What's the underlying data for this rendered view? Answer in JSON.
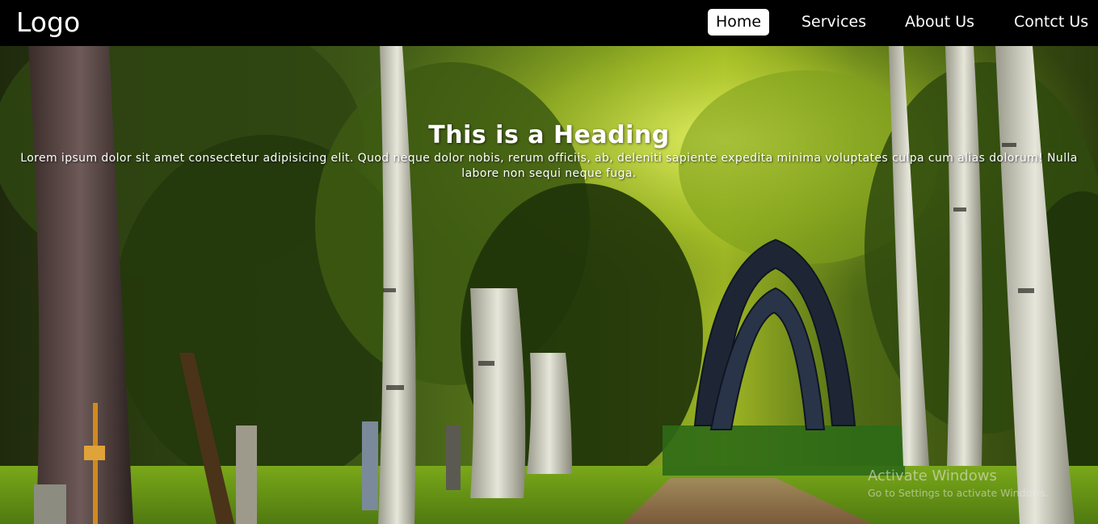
{
  "navbar": {
    "logo": "Logo",
    "links": [
      {
        "label": "Home",
        "active": true
      },
      {
        "label": "Services",
        "active": false
      },
      {
        "label": "About Us",
        "active": false
      },
      {
        "label": "Contct Us",
        "active": false
      }
    ]
  },
  "hero": {
    "heading": "This is a Heading",
    "text": "Lorem ipsum dolor sit amet consectetur adipisicing elit. Quod neque dolor nobis, rerum officiis, ab, deleniti sapiente expedita minima voluptates culpa cum alias dolorum! Nulla labore non sequi neque fuga."
  },
  "watermark": {
    "title": "Activate Windows",
    "subtitle": "Go to Settings to activate Windows."
  },
  "colors": {
    "navbar_bg": "#000000",
    "nav_text": "#ffffff",
    "active_bg": "#ffffff",
    "active_text": "#000000"
  }
}
